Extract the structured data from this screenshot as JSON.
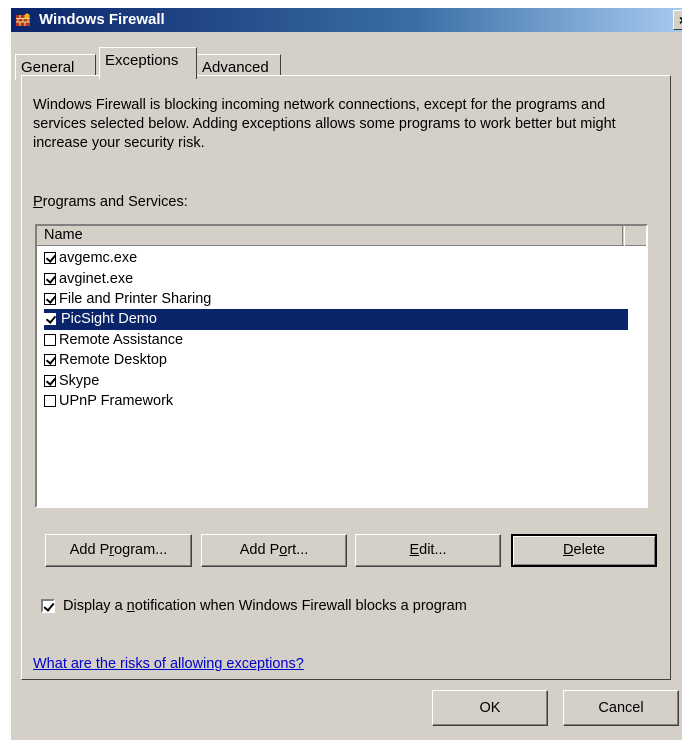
{
  "window": {
    "title": "Windows Firewall",
    "close_label": "×"
  },
  "tabs": [
    {
      "label": "General",
      "active": false
    },
    {
      "label": "Exceptions",
      "active": true
    },
    {
      "label": "Advanced",
      "active": false
    }
  ],
  "intro_text": "Windows Firewall is blocking incoming network connections, except for the programs and services selected below. Adding exceptions allows some programs to work better but might increase your security risk.",
  "programs_label": {
    "mnemonic": "P",
    "rest": "rograms and Services:"
  },
  "list": {
    "column_header": "Name",
    "items": [
      {
        "label": "avgemc.exe",
        "checked": true
      },
      {
        "label": "avginet.exe",
        "checked": true
      },
      {
        "label": "File and Printer Sharing",
        "checked": true
      },
      {
        "label": "PicSight Demo",
        "checked": true,
        "selected": true
      },
      {
        "label": "Remote Assistance",
        "checked": false
      },
      {
        "label": "Remote Desktop",
        "checked": true
      },
      {
        "label": "Skype",
        "checked": true
      },
      {
        "label": "UPnP Framework",
        "checked": false
      }
    ]
  },
  "buttons": {
    "add_program": {
      "pre": "Add P",
      "u": "r",
      "post": "ogram..."
    },
    "add_port": {
      "pre": "Add P",
      "u": "o",
      "post": "rt..."
    },
    "edit": {
      "pre": "",
      "u": "E",
      "post": "dit..."
    },
    "delete": {
      "pre": "",
      "u": "D",
      "post": "elete"
    }
  },
  "notification": {
    "pre": "Display a ",
    "u": "n",
    "post": "otification when Windows Firewall blocks a program",
    "checked": true
  },
  "risks_link": "What are the risks of allowing exceptions?",
  "footer": {
    "ok": "OK",
    "cancel": "Cancel"
  }
}
